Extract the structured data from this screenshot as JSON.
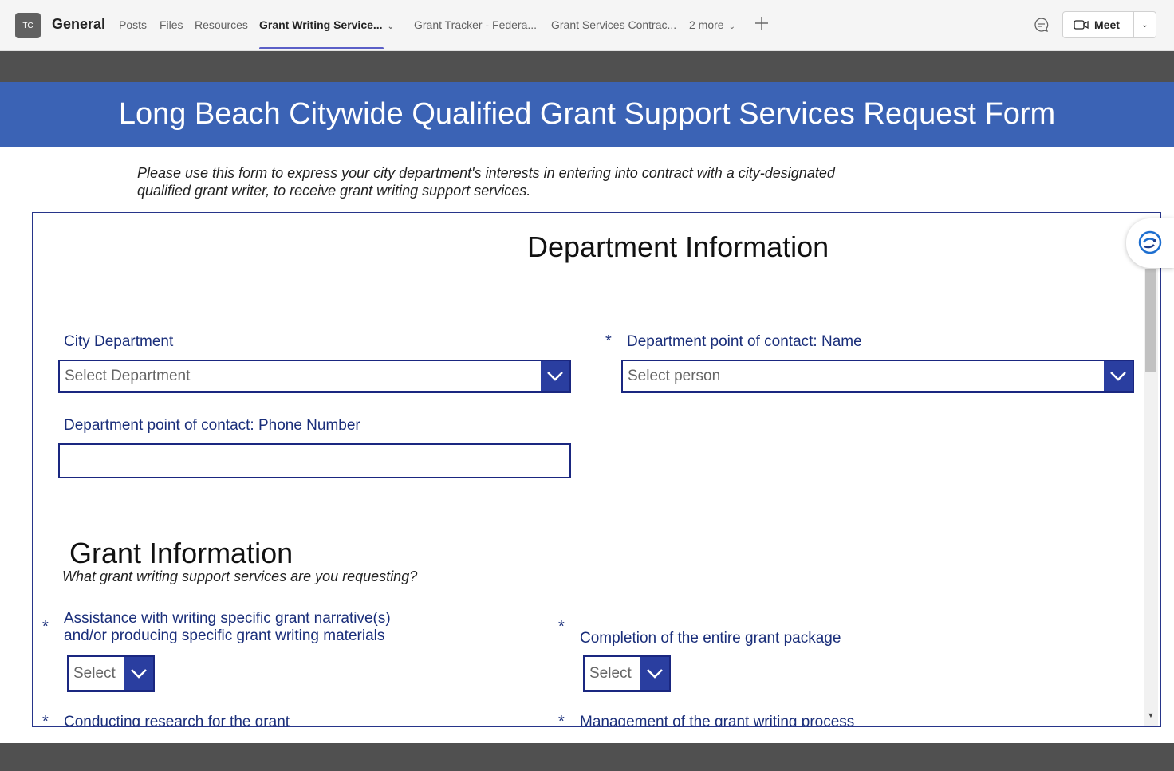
{
  "topbar": {
    "avatar_initials": "TC",
    "channel_title": "General",
    "tabs": [
      {
        "label": "Posts"
      },
      {
        "label": "Files"
      },
      {
        "label": "Resources"
      },
      {
        "label": "Grant Writing Service..."
      },
      {
        "label": "Grant Tracker - Federa..."
      },
      {
        "label": "Grant Services Contrac..."
      },
      {
        "label": "2 more"
      }
    ],
    "meet_label": "Meet",
    "accent_color": "#5b5fc7"
  },
  "form": {
    "title": "Long Beach Citywide Qualified Grant Support Services Request Form",
    "intro_line1": "Please use this form to express your city department's interests in entering into contract with a city-designated",
    "intro_line2": "qualified grant writer, to receive grant writing support services.",
    "banner_color": "#3b63b5",
    "department_section": {
      "title": "Department Information",
      "city_department_label": "City Department",
      "city_department_placeholder": "Select Department",
      "poc_name_label": "Department point of contact: Name",
      "poc_name_placeholder": "Select person",
      "poc_phone_label": "Department point of contact: Phone Number",
      "poc_phone_value": "",
      "required_marker": "*"
    },
    "grant_section": {
      "title": "Grant Information",
      "subtitle": "What grant writing support services are you requesting?",
      "q1_line1": "Assistance with writing specific grant narrative(s)",
      "q1_line2": "and/or producing specific grant writing materials",
      "q1_value": "Select",
      "q2_label": "Completion of the entire grant package",
      "q2_value": "Select",
      "q3_label": "Conducting research for the grant",
      "q4_label": "Management of the grant writing process"
    }
  }
}
